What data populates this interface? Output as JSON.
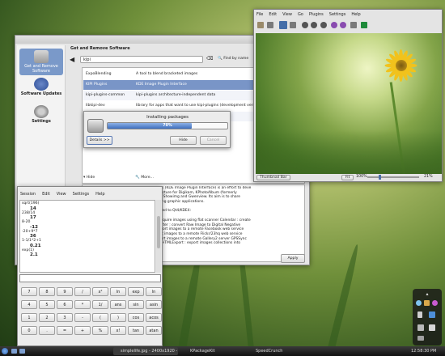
{
  "kpk": {
    "header": "Get and Remove Software",
    "search": "kipi",
    "find_label": "Find by name",
    "filter_label": "Filter",
    "sidebar": [
      {
        "label": "Get and Remove Software"
      },
      {
        "label": "Software Updates"
      },
      {
        "label": "Settings"
      }
    ],
    "rows": [
      {
        "name": "ExpoBlending",
        "desc": "A tool to blend bracketed images"
      },
      {
        "name": "KIPI Plugins",
        "desc": "KDE Image Plugin Interface"
      },
      {
        "name": "kipi-plugins-common",
        "desc": "kipi-plugins architecture-independent data"
      },
      {
        "name": "libkipi-dev",
        "desc": "library for apps that want to use kipi-plugins (development version)"
      },
      {
        "name": "",
        "desc": "(on)"
      },
      {
        "name": "",
        "desc": "(on)"
      }
    ],
    "hide_label": "Hide",
    "more_label": "More...",
    "description": [
      "KIPI plugins (KDE Image Plugin Interface) is an effort to deve",
      "plugin structure for Digikam, KPhotoAlbum (formerly",
      "KimDaBa), Showimg and Gwenview. Its aim is to share",
      "ugins among graphic applications.",
      "",
      "lugins ported to Qt4/KDE4:",
      "",
      "mages : acquire images using flat scanner Calendar : create",
      "DngConverter : convert Raw Image to Digital Negative",
      "import/export images to a remote Facebook web service",
      "ort : export images to a remote Flickr/23hq web service",
      "port : export images to a remote Gallery2 server GPSSync",
      "e pictures HTMLExport : export images collections into",
      "ery"
    ],
    "apply_label": "Apply"
  },
  "dialog": {
    "title": "Installing packages",
    "progress_text": "70%",
    "progress": 0.7,
    "details_label": "Details >>",
    "hide_label": "Hide",
    "cancel_label": "Cancel"
  },
  "viewer": {
    "menu": [
      "File",
      "Edit",
      "View",
      "Go",
      "Plugins",
      "Settings",
      "Help"
    ],
    "thumbnail_bar": "Thumbnail Bar",
    "fit": "Fit",
    "zoom": "100%",
    "size_percent": "21%"
  },
  "calc": {
    "menu": [
      "Session",
      "Edit",
      "View",
      "Settings",
      "Help"
    ],
    "history": [
      {
        "expr": "sqrt(196)",
        "result": "14"
      },
      {
        "expr": "238/14",
        "result": "17"
      },
      {
        "expr": "8-20",
        "result": "-12"
      },
      {
        "expr": "-20+9*7",
        "result": "36"
      },
      {
        "expr": "1-1/1*2+1",
        "result": "0.21"
      },
      {
        "expr": "exp(1)",
        "result": "2.1"
      }
    ],
    "keys": [
      [
        "7",
        "8",
        "9",
        "/",
        "x²",
        "ln",
        "exp",
        "ln"
      ],
      [
        "4",
        "5",
        "6",
        "*",
        "1/",
        "ans",
        "sin",
        "asin"
      ],
      [
        "1",
        "2",
        "3",
        "-",
        "(",
        ")",
        "cos",
        "acos"
      ],
      [
        "0",
        ".",
        "=",
        "+",
        "%",
        "x!",
        "tan",
        "atan"
      ]
    ]
  },
  "taskbar": {
    "tasks": [
      {
        "label": "simplelife.jpg - 2400x1920 -"
      },
      {
        "label": "KPackageKit"
      },
      {
        "label": "SpeedCrunch"
      }
    ],
    "clock": "12:58:30 PM"
  }
}
